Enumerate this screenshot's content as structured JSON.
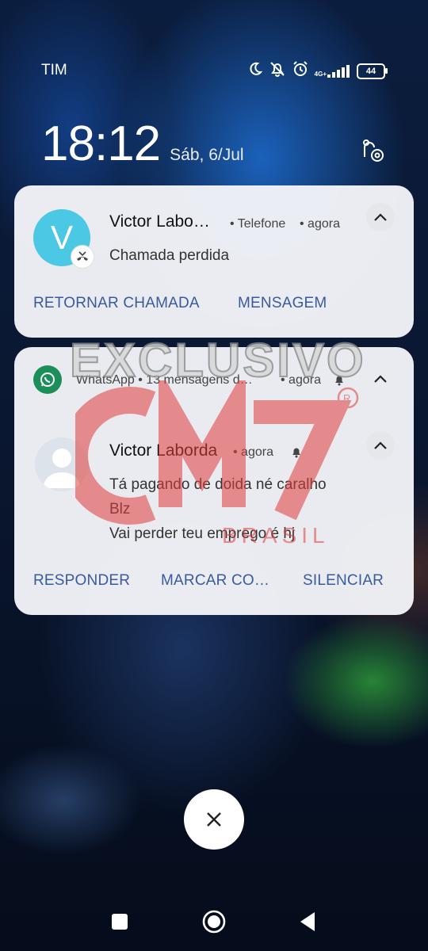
{
  "status_bar": {
    "carrier": "TIM",
    "network": "4G+",
    "battery": "44",
    "icons": [
      "moon-icon",
      "bell-off-icon",
      "alarm-icon",
      "signal-icon",
      "battery-icon"
    ]
  },
  "lockscreen": {
    "time": "18:12",
    "date": "Sáb, 6/Jul"
  },
  "notifications": [
    {
      "avatar_letter": "V",
      "title": "Victor Labo…",
      "app": "• Telefone",
      "time": "• agora",
      "body": "Chamada perdida",
      "actions": [
        "RETORNAR CHAMADA",
        "MENSAGEM"
      ],
      "accent": "#4bc8e3"
    },
    {
      "app_header": "WhatsApp • 13 mensagens d…",
      "app_time": "• agora",
      "sender": "Victor Laborda",
      "time": "• agora",
      "messages": [
        "Tá pagando de doida né caralho",
        "Blz",
        "Vai perder teu emprego é hj"
      ],
      "actions": [
        "RESPONDER",
        "MARCAR CO…",
        "SILENCIAR"
      ],
      "accent": "#1b8e5a"
    }
  ],
  "watermark": {
    "word": "EXCLUSIVO",
    "logo": "CM7",
    "logo_sub": "BRASIL"
  },
  "colors": {
    "action_text": "#385b9c",
    "card_bg": "#f2f3f7",
    "watermark_red": "#e23b3b"
  }
}
